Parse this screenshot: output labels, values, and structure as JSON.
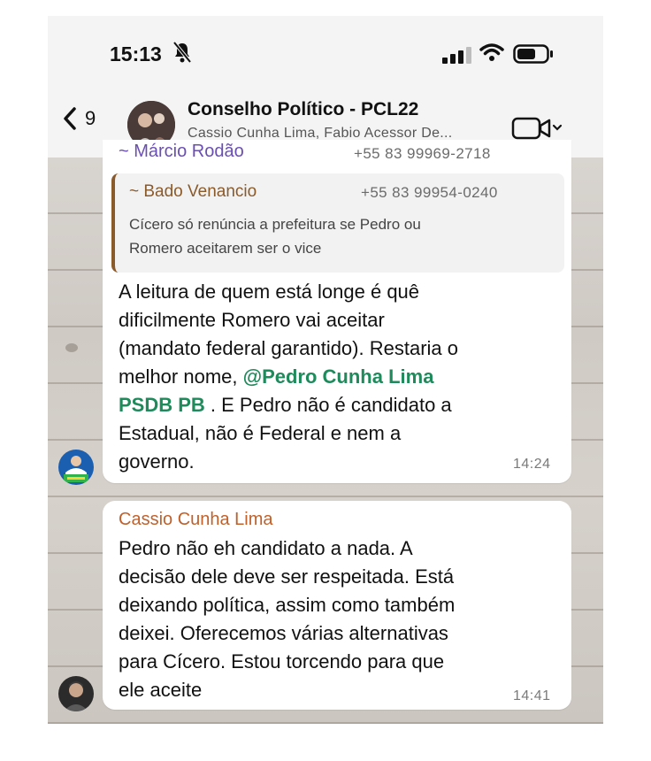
{
  "status_bar": {
    "time": "15:13"
  },
  "header": {
    "back_count": "9",
    "title": "Conselho Político - PCL22",
    "subtitle": "Cassio Cunha Lima, Fabio Acessor De..."
  },
  "messages": [
    {
      "sender": "~ Márcio Rodão",
      "sender_color": "#6a4fb3",
      "phone": "+55 83 99969-2718",
      "quote": {
        "sender": "~ Bado Venancio",
        "phone": "+55 83 99954-0240",
        "text_1": "Cícero só renúncia a prefeitura se Pedro ou",
        "text_2": "Romero aceitarem ser o vice"
      },
      "line_1": "A leitura de quem está longe é quê",
      "line_2": "dificilmente Romero vai aceitar",
      "line_3": "(mandato federal garantido). Restaria o",
      "line_4_prefix": "melhor nome, ",
      "mention_1": "@Pedro Cunha Lima",
      "mention_2": "PSDB PB",
      "line_5_suffix": " . E Pedro não é candidato a",
      "line_6": "Estadual, não é Federal e nem a",
      "line_7": "governo.",
      "time": "14:24",
      "avatar_label": "MARCIO 11789"
    },
    {
      "sender": "Cassio Cunha Lima",
      "sender_color": "#c0602a",
      "line_1": "Pedro não eh candidato a nada. A",
      "line_2": "decisão dele deve ser respeitada. Está",
      "line_3": "deixando política, assim como também",
      "line_4": "deixei. Oferecemos várias alternativas",
      "line_5": "para Cícero. Estou torcendo para que",
      "line_6": "ele aceite",
      "time": "14:41"
    }
  ]
}
